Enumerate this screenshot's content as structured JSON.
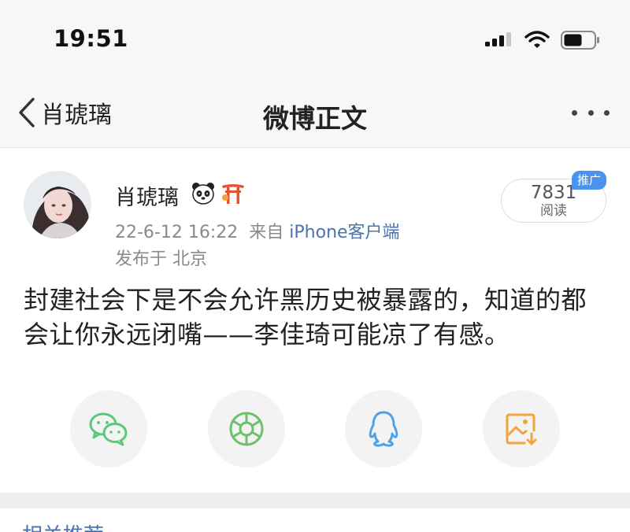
{
  "status_bar": {
    "time": "19:51",
    "icons": [
      "cellular-signal-icon",
      "wifi-icon",
      "battery-icon"
    ]
  },
  "nav": {
    "back_label": "肖琥璃",
    "title": "微博正文",
    "more_icon": "more-dots-icon"
  },
  "post": {
    "author": "肖琥璃",
    "badges": [
      "panda-icon",
      "shrine-gate-icon"
    ],
    "date": "22-6-12 16:22",
    "source_prefix": "来自",
    "source_name": "iPhone客户端",
    "location": "发布于 北京",
    "read_count": "7831",
    "read_label": "阅读",
    "promo_tag": "推广",
    "body": "封建社会下是不会允许黑历史被暴露的，知道的都会让你永远闭嘴——李佳琦可能凉了有感。"
  },
  "share": {
    "buttons": [
      {
        "icon": "wechat-icon",
        "color": "#5cc87a"
      },
      {
        "icon": "moments-icon",
        "color": "#6cc16a"
      },
      {
        "icon": "qq-icon",
        "color": "#4ea3e8"
      },
      {
        "icon": "save-image-icon",
        "color": "#f0a43a"
      }
    ]
  },
  "related": {
    "title": "相关推荐"
  },
  "colors": {
    "link": "#4a73b0",
    "promo": "#4c93f0",
    "meta_gray": "#8a8a8a"
  }
}
